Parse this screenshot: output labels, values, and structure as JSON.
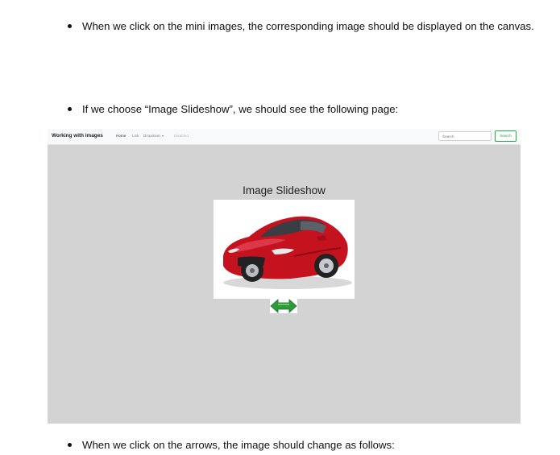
{
  "bullets": [
    "When we click on the mini images, the corresponding image should be displayed on the canvas.",
    "If we choose “Image Slideshow”, we should see the following page:",
    "When we click on the arrows, the image should change as follows:"
  ],
  "screenshot": {
    "navbar": {
      "brand": "Working with images",
      "links": [
        "Home",
        "Link",
        "Dropdown",
        "Disabled"
      ],
      "search_placeholder": "Search",
      "search_button": "Search"
    },
    "title": "Image Slideshow",
    "image_icon": "red-sports-car",
    "arrow_icon": "left-right-arrows-icon",
    "background_color": "#d3d3d3",
    "accent_color": "#28a745"
  }
}
